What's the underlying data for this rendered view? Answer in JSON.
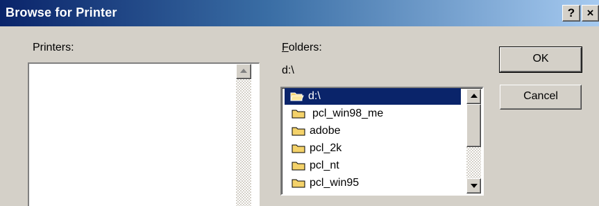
{
  "window": {
    "title": "Browse for Printer",
    "help_button": "?",
    "close_button": "×"
  },
  "printers": {
    "label": "Printers:",
    "items": []
  },
  "folders": {
    "label": "Folders:",
    "label_access_key": "F",
    "label_rest": "olders:",
    "current_path": "d:\\",
    "items": [
      {
        "label": "d:\\",
        "icon": "open-folder-icon",
        "selected": true
      },
      {
        "label": "pcl_win98_me",
        "icon": "folder-icon",
        "selected": false
      },
      {
        "label": "adobe",
        "icon": "folder-icon",
        "selected": false
      },
      {
        "label": "pcl_2k",
        "icon": "folder-icon",
        "selected": false
      },
      {
        "label": "pcl_nt",
        "icon": "folder-icon",
        "selected": false
      },
      {
        "label": "pcl_win95",
        "icon": "folder-icon",
        "selected": false
      }
    ]
  },
  "buttons": {
    "ok": "OK",
    "cancel": "Cancel"
  },
  "colors": {
    "face": "#d4d0c8",
    "title_start": "#0a246a",
    "title_end": "#a6caf0",
    "selection": "#0a246a",
    "folder": "#f4d26a"
  }
}
